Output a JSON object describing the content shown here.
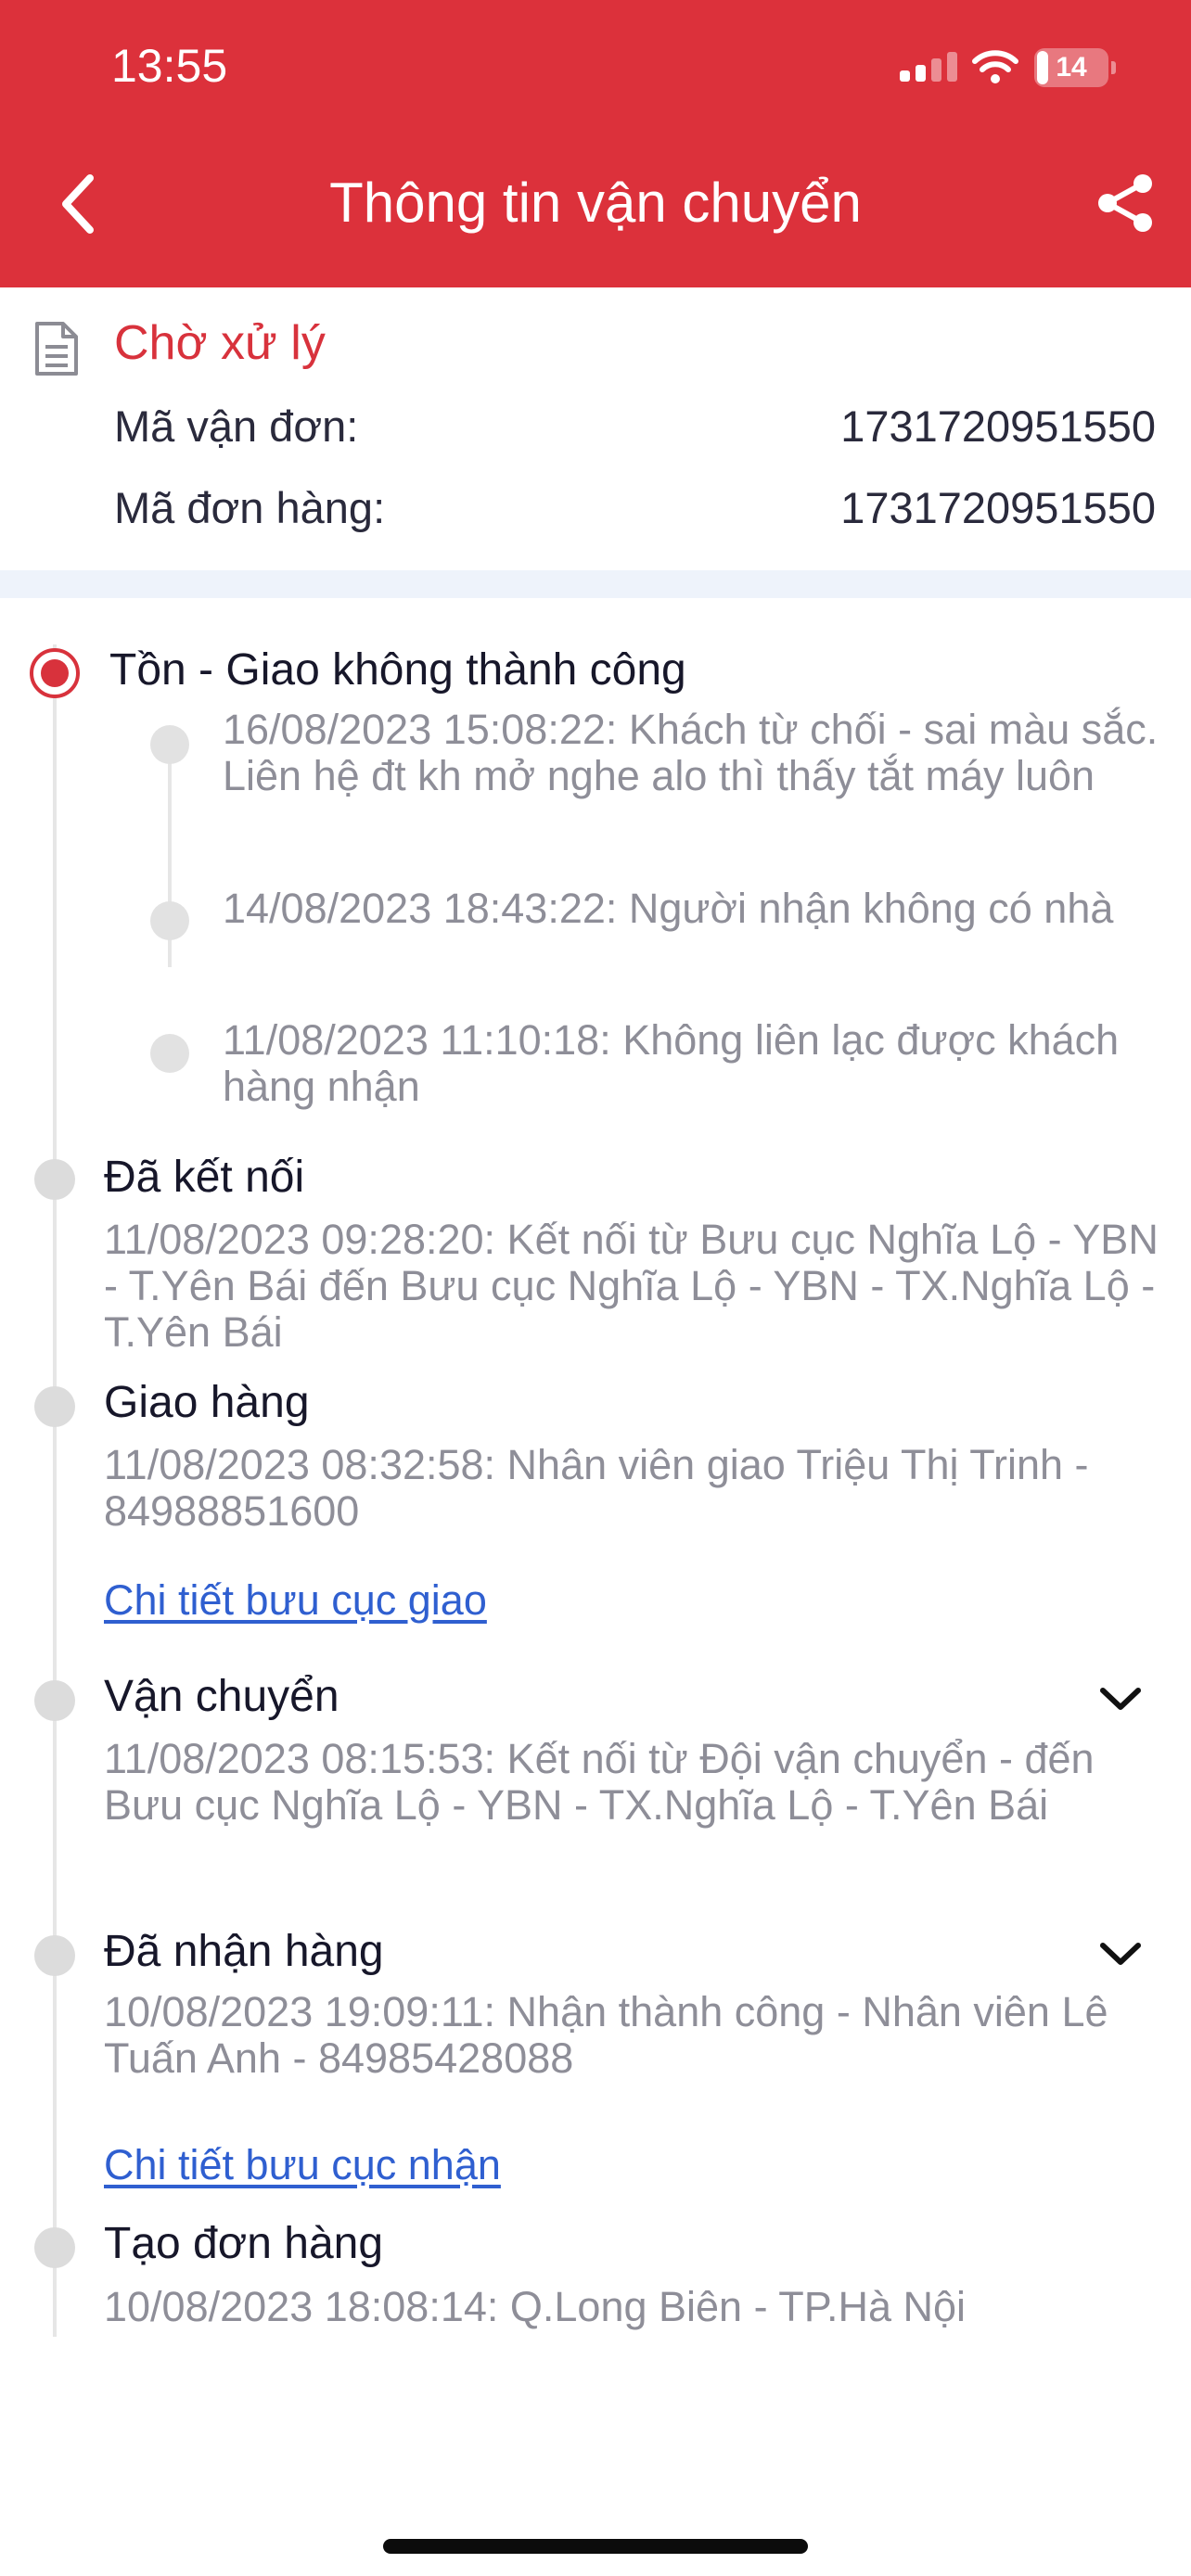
{
  "status_bar": {
    "time": "13:55",
    "battery": "14"
  },
  "header": {
    "title": "Thông tin vận chuyển",
    "back_icon": "chevron-left-icon",
    "share_icon": "share-icon",
    "background_color": "#dc313b"
  },
  "summary": {
    "status": "Chờ xử lý",
    "waybill_label": "Mã vận đơn:",
    "waybill_value": "1731720951550",
    "order_label": "Mã đơn hàng:",
    "order_value": "1731720951550"
  },
  "timeline": [
    {
      "title": "Tồn - Giao không thành công",
      "active": true,
      "sub_events": [
        "16/08/2023 15:08:22: Khách từ chối - sai màu sắc. Liên hệ đt kh mở nghe alo thì thấy tắt máy luôn",
        "14/08/2023 18:43:22: Người nhận không có nhà",
        "11/08/2023 11:10:18: Không liên lạc được khách hàng nhận"
      ]
    },
    {
      "title": "Đã kết nối",
      "text": "11/08/2023 09:28:20: Kết nối từ Bưu cục Nghĩa Lộ - YBN - T.Yên Bái đến Bưu cục Nghĩa Lộ - YBN - TX.Nghĩa Lộ - T.Yên Bái"
    },
    {
      "title": "Giao hàng",
      "text": "11/08/2023 08:32:58: Nhân viên giao Triệu Thị Trinh - 84988851600",
      "link": "Chi tiết bưu cục giao"
    },
    {
      "title": "Vận chuyển",
      "text": "11/08/2023 08:15:53: Kết nối từ Đội vận chuyển - đến Bưu cục Nghĩa Lộ - YBN - TX.Nghĩa Lộ - T.Yên Bái",
      "expandable": true
    },
    {
      "title": "Đã nhận hàng",
      "text": "10/08/2023 19:09:11: Nhận thành công - Nhân viên Lê Tuấn Anh - 84985428088",
      "link": "Chi tiết bưu cục nhận",
      "expandable": true
    },
    {
      "title": "Tạo đơn hàng",
      "text": "10/08/2023 18:08:14: Q.Long Biên - TP.Hà Nội"
    }
  ],
  "colors": {
    "accent": "#d8323c",
    "link": "#2f5fd0",
    "muted_text": "#8e8e98"
  }
}
